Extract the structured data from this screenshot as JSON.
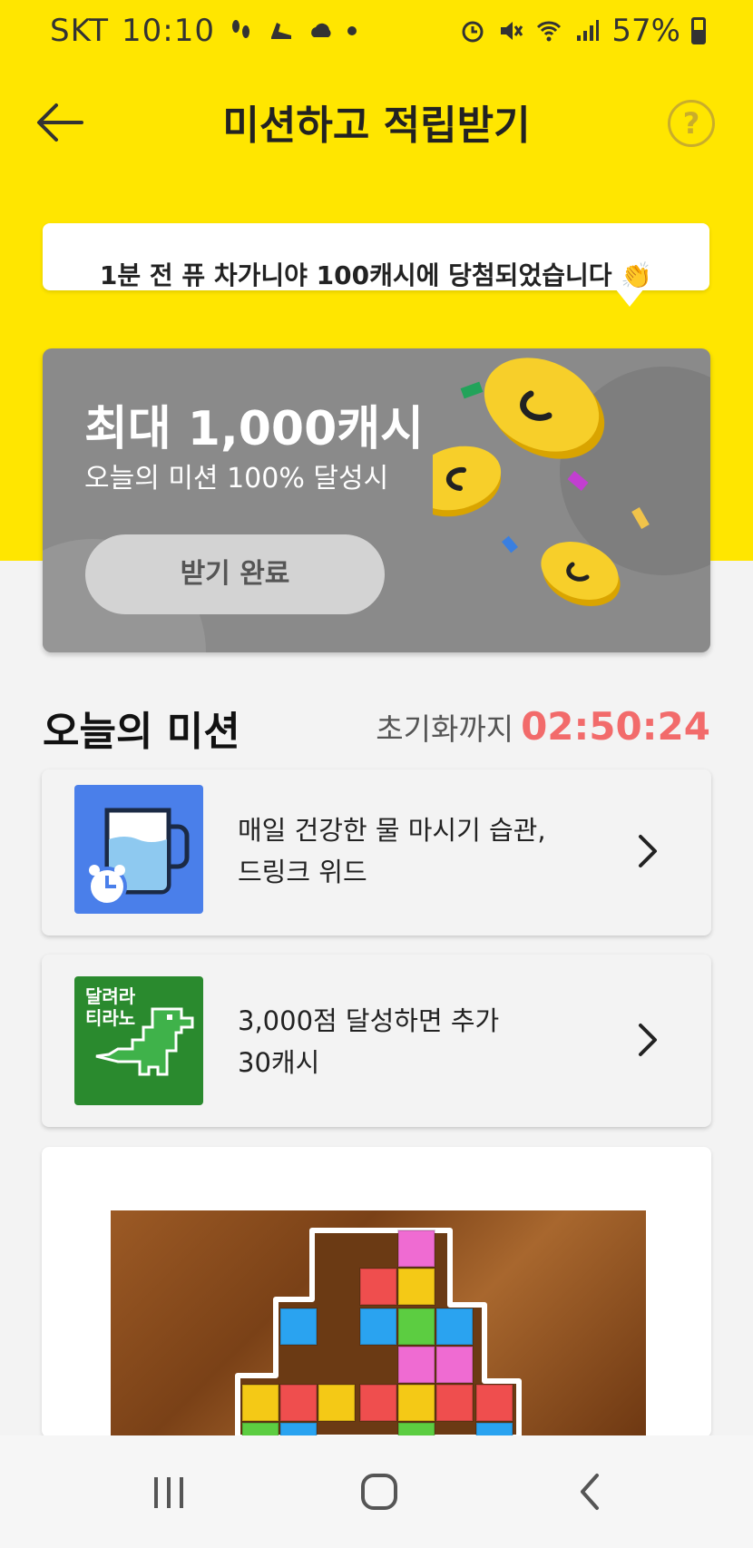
{
  "status_bar": {
    "carrier": "SKT",
    "time": "10:10",
    "battery": "57%"
  },
  "header": {
    "title": "미션하고 적립받기",
    "help_label": "?"
  },
  "ticker": {
    "text": "1분 전 퓨 차가니야 100캐시에 당첨되었습니다 👏"
  },
  "reward": {
    "title": "최대 1,000캐시",
    "subtitle": "오늘의 미션 100% 달성시",
    "button_label": "받기 완료"
  },
  "missions_section": {
    "title": "오늘의 미션",
    "reset_label": "초기화까지",
    "reset_time": "02:50:24"
  },
  "missions": [
    {
      "text": "매일 건강한 물 마시기 습관,\n드링크 위드"
    },
    {
      "text": "3,000점 달성하면 추가\n30캐시",
      "thumb_label": "달려라\n티라노"
    }
  ],
  "colors": {
    "brand_yellow": "#ffe600",
    "timer_red": "#f26b6b",
    "banner_gray": "#8a8a8a",
    "coin_gold": "#f5c518"
  },
  "icons": [
    "back-arrow-icon",
    "help-icon",
    "chevron-right-icon",
    "alarm-clock-icon",
    "recent-apps-icon",
    "home-icon",
    "nav-back-icon"
  ]
}
